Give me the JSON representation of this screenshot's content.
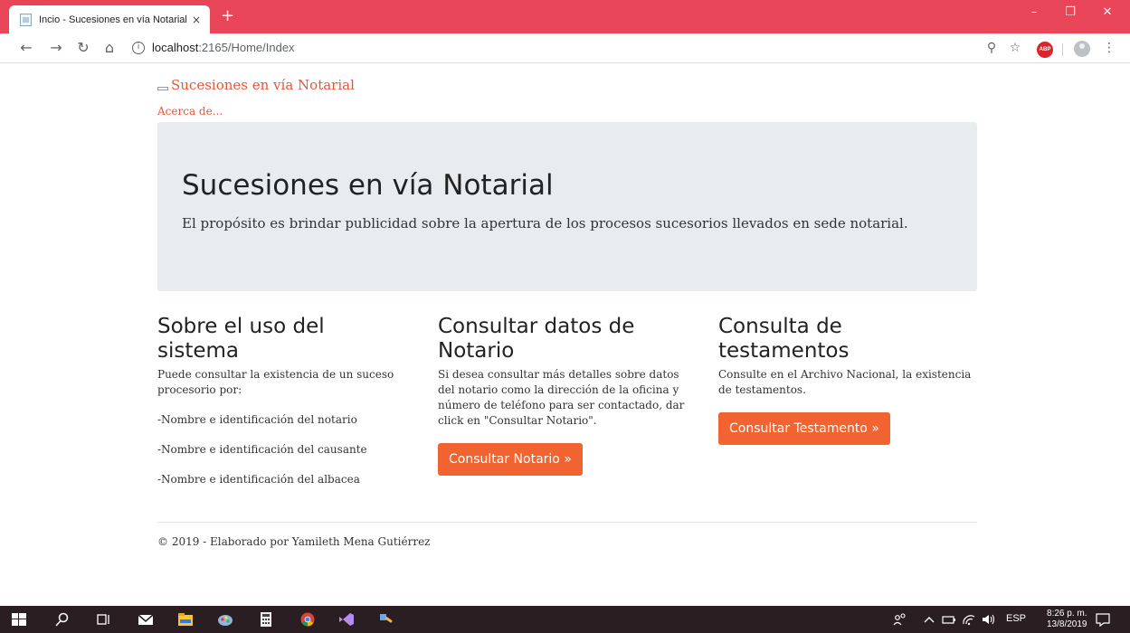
{
  "browser": {
    "tab_title": "Incio - Sucesiones en vía Notarial",
    "tab_close": "×",
    "new_tab": "+",
    "url_host": "localhost",
    "url_path": ":2165/Home/Index",
    "info_glyph": "i",
    "abp_label": "ABP"
  },
  "nav": {
    "brand": "Sucesiones en vía Notarial",
    "about": "Acerca de..."
  },
  "jumbotron": {
    "title": "Sucesiones en vía Notarial",
    "lead": "El propósito es brindar publicidad sobre la apertura de los procesos sucesorios llevados en sede notarial."
  },
  "columns": {
    "uso": {
      "title_line1": "Sobre el uso del",
      "title_line2": "sistema",
      "text": "Puede consultar la existencia de un suceso procesorio por:",
      "items": [
        "-Nombre e identificación del notario",
        "-Nombre e identificación del causante",
        "-Nombre e identificación del albacea"
      ]
    },
    "notario": {
      "title_line1": "Consultar datos de",
      "title_line2": "Notario",
      "text": "Si desea consultar más detalles sobre datos del notario como la dirección de la oficina y número de teléfono para ser contactado, dar click en \"Consultar Notario\".",
      "button": "Consultar Notario »"
    },
    "testamentos": {
      "title_line1": "Consulta de",
      "title_line2": "testamentos",
      "text": "Consulte en el Archivo Nacional, la existencia de testamentos.",
      "button": "Consultar Testamento »"
    }
  },
  "footer": {
    "text": "© 2019 - Elaborado por Yamileth Mena Gutiérrez"
  },
  "taskbar": {
    "lang": "ESP",
    "time": "8:26 p. m.",
    "date": "13/8/2019"
  },
  "colors": {
    "accent": "#f16432",
    "link": "#e8553a",
    "titlebar": "#e84658",
    "jumbotron": "#e9ecef",
    "taskbar": "#2b1e22"
  }
}
